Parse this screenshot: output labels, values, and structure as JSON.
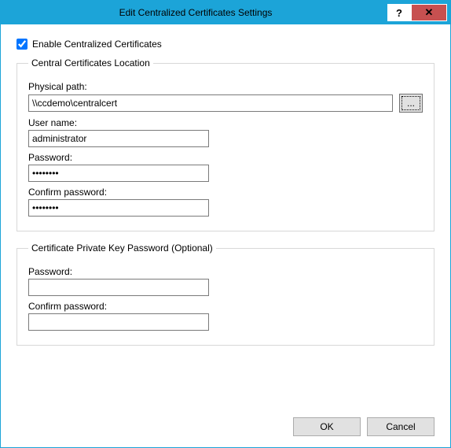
{
  "title": "Edit Centralized Certificates Settings",
  "titlebar": {
    "help": "?",
    "close": "✕"
  },
  "enable": {
    "label": "Enable Centralized Certificates",
    "checked": true
  },
  "groups": {
    "location": {
      "legend": "Central Certificates Location",
      "physical_path_label": "Physical path:",
      "physical_path_value": "\\\\ccdemo\\centralcert",
      "browse_label": "...",
      "username_label": "User name:",
      "username_value": "administrator",
      "password_label": "Password:",
      "password_value": "••••••••",
      "confirm_label": "Confirm password:",
      "confirm_value": "••••••••"
    },
    "privatekey": {
      "legend": "Certificate Private Key Password (Optional)",
      "password_label": "Password:",
      "password_value": "",
      "confirm_label": "Confirm password:",
      "confirm_value": ""
    }
  },
  "buttons": {
    "ok": "OK",
    "cancel": "Cancel"
  }
}
